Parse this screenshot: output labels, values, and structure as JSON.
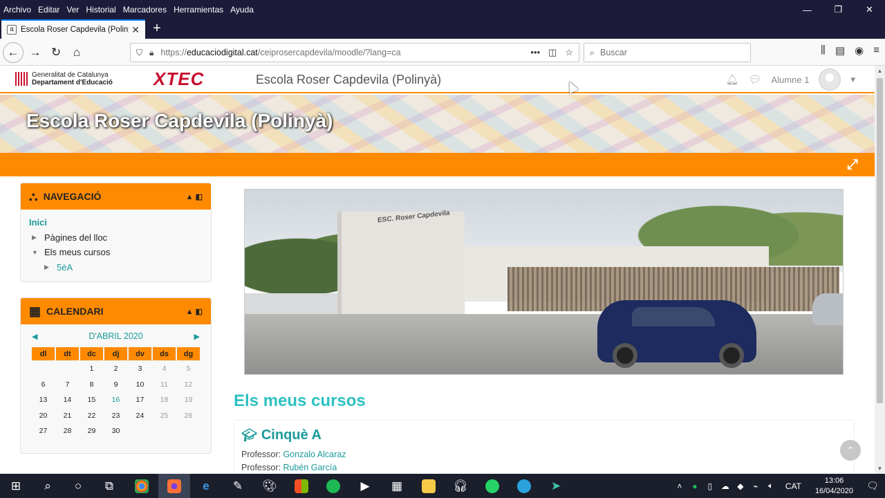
{
  "browser": {
    "menu": [
      "Archivo",
      "Editar",
      "Ver",
      "Historial",
      "Marcadores",
      "Herramientas",
      "Ayuda"
    ],
    "window_controls": [
      "—",
      "❐",
      "✕"
    ],
    "tab": {
      "title": "Escola Roser Capdevila (Poliny…",
      "favicon": "a",
      "close": "✕"
    },
    "newtab": "+",
    "url": {
      "pre": "https://",
      "host": "educaciodigital.cat",
      "post": "/ceiprosercapdevila/moodle/?lang=ca"
    },
    "search_placeholder": "Buscar"
  },
  "site_header": {
    "gencat_line1": "Generalitat de Catalunya",
    "gencat_line2": "Departament d'Educació",
    "xtec": "XTEC",
    "site_name": "Escola Roser Capdevila (Polinyà)",
    "user": "Alumne 1"
  },
  "banner_title": "Escola Roser Capdevila (Polinyà)",
  "navigation": {
    "title": "NAVEGACIÓ",
    "home": "Inici",
    "items": [
      {
        "label": "Pàgines del lloc"
      },
      {
        "label": "Els meus cursos"
      },
      {
        "label": "5èA"
      }
    ]
  },
  "calendar": {
    "title": "CALENDARI",
    "month": "D'ABRIL 2020",
    "weekdays": [
      "dl",
      "dt",
      "dc",
      "dj",
      "dv",
      "ds",
      "dg"
    ],
    "weeks": [
      [
        "",
        "",
        "1",
        "2",
        "3",
        "4",
        "5"
      ],
      [
        "6",
        "7",
        "8",
        "9",
        "10",
        "11",
        "12"
      ],
      [
        "13",
        "14",
        "15",
        "16",
        "17",
        "18",
        "19"
      ],
      [
        "20",
        "21",
        "22",
        "23",
        "24",
        "25",
        "26"
      ],
      [
        "27",
        "28",
        "29",
        "30",
        "",
        "",
        ""
      ]
    ],
    "today": "16"
  },
  "photo_sign": "ESC. Roser Capdevila",
  "main": {
    "section_title": "Els meus cursos",
    "course": {
      "name": "Cinquè A",
      "teacher_label": "Professor:",
      "teachers": [
        "Gonzalo Alcaraz",
        "Rubén García"
      ]
    }
  },
  "taskbar": {
    "lang": "CAT",
    "time": "13:06",
    "date": "16/04/2020"
  },
  "colors": {
    "accent_orange": "#ff8a00",
    "link_teal": "#1b9a9a",
    "title_teal": "#2ec1c1",
    "chrome_dark": "#1c1b39"
  }
}
